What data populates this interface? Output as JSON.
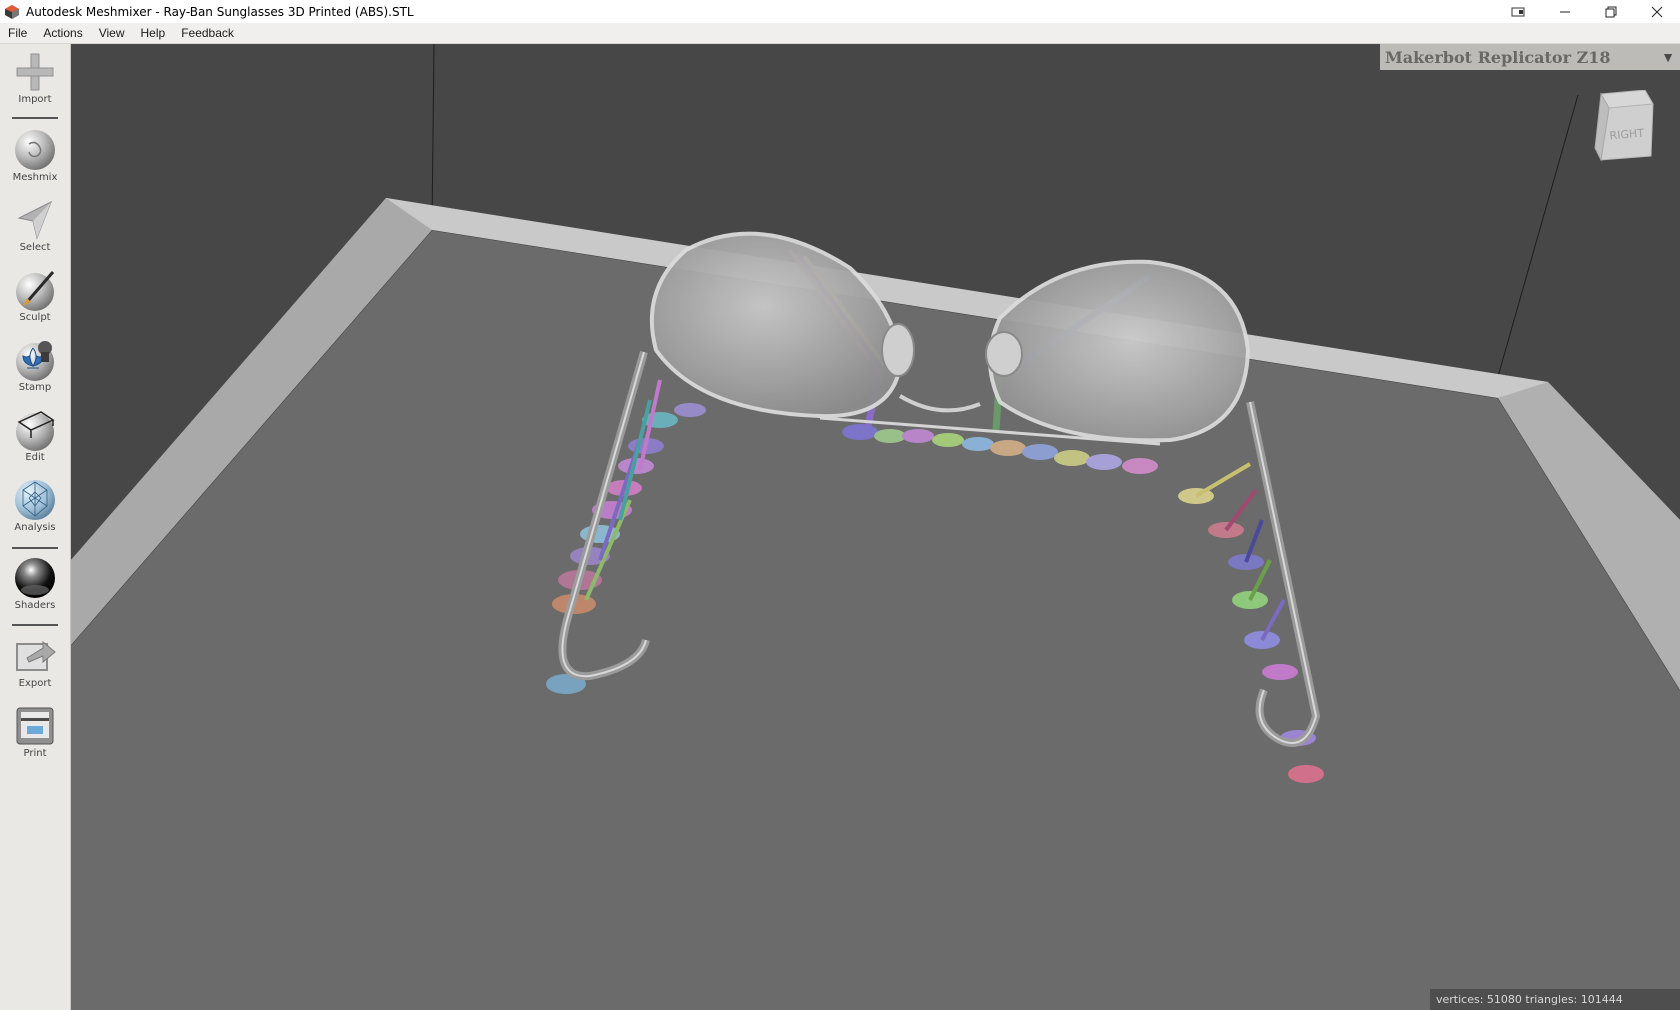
{
  "window": {
    "title": "Autodesk Meshmixer - Ray-Ban Sunglasses 3D Printed (ABS).STL",
    "controls": [
      "minimize",
      "restore",
      "close"
    ]
  },
  "menu": {
    "items": [
      "File",
      "Actions",
      "View",
      "Help",
      "Feedback"
    ]
  },
  "toolbar": {
    "tools": [
      {
        "label": "Import",
        "icon": "plus-icon"
      },
      {
        "label": "Meshmix",
        "icon": "bunny-sphere-icon"
      },
      {
        "label": "Select",
        "icon": "arrow-cursor-icon"
      },
      {
        "label": "Sculpt",
        "icon": "brush-sphere-icon"
      },
      {
        "label": "Stamp",
        "icon": "fleur-stamp-icon"
      },
      {
        "label": "Edit",
        "icon": "wire-box-sphere-icon"
      },
      {
        "label": "Analysis",
        "icon": "mesh-sphere-icon"
      },
      {
        "label": "Shaders",
        "icon": "shaded-sphere-icon"
      },
      {
        "label": "Export",
        "icon": "export-icon"
      },
      {
        "label": "Print",
        "icon": "printer-icon"
      }
    ]
  },
  "printer": {
    "name": "Makerbot Replicator Z18"
  },
  "viewcube": {
    "face": "RIGHT"
  },
  "status": {
    "text": "vertices: 51080 triangles: 101444"
  },
  "colors": {
    "viewport_bg": "#474747",
    "build_plate": "#6b6b6b",
    "plate_rim": "#b9b9b9",
    "toolbar_bg": "#eae8e5"
  }
}
